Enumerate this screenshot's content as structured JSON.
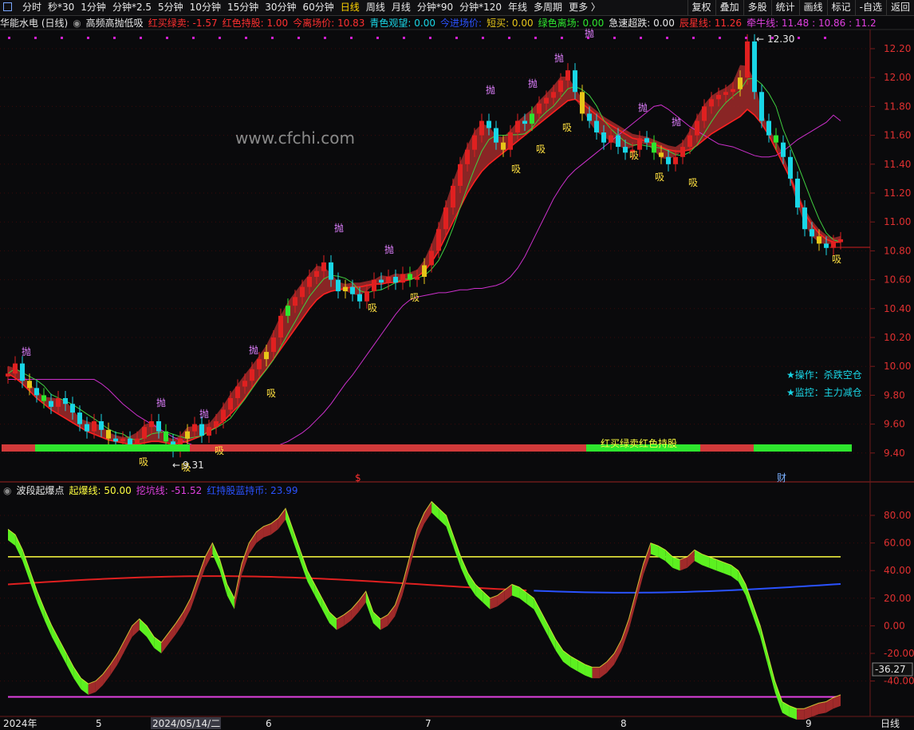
{
  "toolbar": {
    "periods": [
      "分时",
      "秒*30",
      "1分钟",
      "分钟*2.5",
      "5分钟",
      "10分钟",
      "15分钟",
      "30分钟",
      "60分钟",
      "日线",
      "周线",
      "月线",
      "分钟*90",
      "分钟*120",
      "年线",
      "多周期",
      "更多 〉"
    ],
    "active_period": "日线",
    "right_buttons": [
      "复权",
      "叠加",
      "多股",
      "统计",
      "画线",
      "标记",
      "-自选",
      "返回"
    ]
  },
  "main_header": {
    "stock": "华能水电 (日线)",
    "indicator": "高频高抛低吸",
    "items": [
      {
        "label": "红买绿卖:",
        "value": "-1.57",
        "color": "#ff3030"
      },
      {
        "label": "红色持股:",
        "value": "1.00",
        "color": "#ff3030"
      },
      {
        "label": "今离场价:",
        "value": "10.83",
        "color": "#ff3030"
      },
      {
        "label": "青色观望:",
        "value": "0.00",
        "color": "#19d6e6"
      },
      {
        "label": "今进场价:",
        "value": "",
        "color": "#2a52ff"
      },
      {
        "label": "短买:",
        "value": "0.00",
        "color": "#e6c619"
      },
      {
        "label": "绿色离场:",
        "value": "0.00",
        "color": "#2ee62e"
      },
      {
        "label": "急速超跌:",
        "value": "0.00",
        "color": "#e8e8e8"
      },
      {
        "label": "辰星线:",
        "value": "11.26",
        "color": "#ff3030"
      },
      {
        "label": "牵牛线:",
        "value": "11.48 : 10.86 : 11.2",
        "color": "#e040e0"
      }
    ]
  },
  "sub_header": {
    "indicator": "波段起爆点",
    "items": [
      {
        "label": "起爆线:",
        "value": "50.00",
        "color": "#ffff40"
      },
      {
        "label": "挖坑线:",
        "value": "-51.52",
        "color": "#e040e0"
      },
      {
        "label": "红持股蓝持币:",
        "value": "23.99",
        "color": "#2a52ff"
      }
    ]
  },
  "watermark": "www.cfchi.com",
  "annotations": {
    "op_label": "★操作：杀跌空仓",
    "monitor_label": "★监控：主力减仓",
    "band_label": "红买绿卖红色持股",
    "high_label": "12.30",
    "low_label": "9.31",
    "sell_mark": "抛",
    "buy_mark": "吸",
    "event_s": "$",
    "event_cai": "财",
    "current_sub_value": "-36.27"
  },
  "price_axis": [
    "12.20",
    "12.00",
    "11.80",
    "11.60",
    "11.40",
    "11.20",
    "11.00",
    "10.80",
    "10.60",
    "10.40",
    "10.20",
    "10.00",
    "9.80",
    "9.60",
    "9.40"
  ],
  "sub_axis": [
    "80.00",
    "60.00",
    "40.00",
    "20.00",
    "0.00",
    "-20.00",
    "-40.00"
  ],
  "date_axis": [
    "2024年",
    "5",
    "2024/05/14/二",
    "6",
    "7",
    "8",
    "9",
    "日线"
  ],
  "colors": {
    "up": "#e02020",
    "down": "#19d6e6",
    "buy_signal": "#2ee62e",
    "hold": "#e6c619",
    "cloud": "#a02a2a",
    "cloud_green": "#8a9a3a",
    "ma_red": "#ff2020",
    "ma_purple": "#cc30cc",
    "ma_green": "#40d040",
    "threshold_yellow": "#ffff40",
    "blue": "#2a52ff"
  },
  "chart_data": {
    "type": "candlestick",
    "price_range": [
      9.3,
      12.3
    ],
    "closes": [
      9.95,
      10.02,
      9.9,
      9.85,
      9.8,
      9.76,
      9.72,
      9.78,
      9.74,
      9.68,
      9.6,
      9.55,
      9.62,
      9.56,
      9.5,
      9.48,
      9.5,
      9.46,
      9.5,
      9.58,
      9.62,
      9.55,
      9.48,
      9.42,
      9.5,
      9.55,
      9.6,
      9.52,
      9.58,
      9.62,
      9.7,
      9.78,
      9.86,
      9.9,
      9.98,
      10.05,
      10.1,
      10.2,
      10.35,
      10.42,
      10.48,
      10.55,
      10.62,
      10.66,
      10.72,
      10.6,
      10.52,
      10.55,
      10.5,
      10.45,
      10.52,
      10.6,
      10.58,
      10.62,
      10.58,
      10.64,
      10.6,
      10.62,
      10.7,
      10.8,
      10.95,
      11.1,
      11.25,
      11.4,
      11.5,
      11.6,
      11.7,
      11.65,
      11.55,
      11.5,
      11.62,
      11.7,
      11.68,
      11.75,
      11.82,
      11.86,
      11.9,
      11.98,
      12.05,
      11.9,
      11.75,
      11.7,
      11.62,
      11.55,
      11.6,
      11.52,
      11.48,
      11.5,
      11.58,
      11.55,
      11.48,
      11.45,
      11.4,
      11.45,
      11.52,
      11.6,
      11.7,
      11.8,
      11.85,
      11.88,
      11.9,
      11.92,
      12.0,
      12.25,
      11.9,
      11.7,
      11.6,
      11.55,
      11.45,
      11.3,
      11.1,
      10.95,
      10.9,
      10.85,
      10.82,
      10.86,
      10.88
    ],
    "ma_red": [
      9.95,
      9.92,
      9.88,
      9.83,
      9.78,
      9.74,
      9.7,
      9.67,
      9.64,
      9.61,
      9.58,
      9.55,
      9.53,
      9.51,
      9.49,
      9.48,
      9.47,
      9.46,
      9.46,
      9.47,
      9.48,
      9.48,
      9.47,
      9.46,
      9.47,
      9.48,
      9.5,
      9.52,
      9.55,
      9.58,
      9.62,
      9.67,
      9.72,
      9.78,
      9.85,
      9.92,
      9.98,
      10.05,
      10.12,
      10.19,
      10.26,
      10.33,
      10.4,
      10.46,
      10.5,
      10.52,
      10.53,
      10.54,
      10.55,
      10.55,
      10.56,
      10.57,
      10.57,
      10.58,
      10.58,
      10.59,
      10.6,
      10.62,
      10.66,
      10.72,
      10.8,
      10.9,
      11.0,
      11.1,
      11.2,
      11.28,
      11.35,
      11.4,
      11.44,
      11.48,
      11.52,
      11.56,
      11.6,
      11.64,
      11.68,
      11.72,
      11.76,
      11.8,
      11.84,
      11.85,
      11.82,
      11.78,
      11.74,
      11.7,
      11.67,
      11.64,
      11.61,
      11.58,
      11.57,
      11.56,
      11.54,
      11.52,
      11.5,
      11.49,
      11.49,
      11.5,
      11.53,
      11.57,
      11.61,
      11.64,
      11.67,
      11.7,
      11.73,
      11.78,
      11.74,
      11.68,
      11.6,
      11.5,
      11.4,
      11.3,
      11.18,
      11.06,
      10.98,
      10.92,
      10.88,
      10.86,
      10.86
    ],
    "sub_values": [
      70,
      66,
      55,
      40,
      25,
      12,
      0,
      -10,
      -20,
      -30,
      -38,
      -42,
      -40,
      -35,
      -28,
      -20,
      -10,
      0,
      5,
      0,
      -8,
      -12,
      -5,
      2,
      10,
      20,
      35,
      50,
      60,
      48,
      30,
      20,
      45,
      60,
      68,
      72,
      74,
      78,
      85,
      70,
      55,
      40,
      30,
      20,
      10,
      5,
      8,
      12,
      18,
      25,
      10,
      5,
      8,
      15,
      30,
      50,
      70,
      82,
      90,
      85,
      80,
      65,
      50,
      38,
      30,
      25,
      20,
      22,
      26,
      30,
      28,
      24,
      20,
      10,
      0,
      -10,
      -18,
      -22,
      -25,
      -28,
      -30,
      -30,
      -26,
      -20,
      -10,
      5,
      25,
      45,
      60,
      58,
      55,
      50,
      48,
      50,
      55,
      52,
      50,
      48,
      46,
      44,
      40,
      30,
      15,
      0,
      -20,
      -40,
      -55,
      -58,
      -60,
      -60,
      -58,
      -56,
      -55,
      -52,
      -50
    ]
  }
}
